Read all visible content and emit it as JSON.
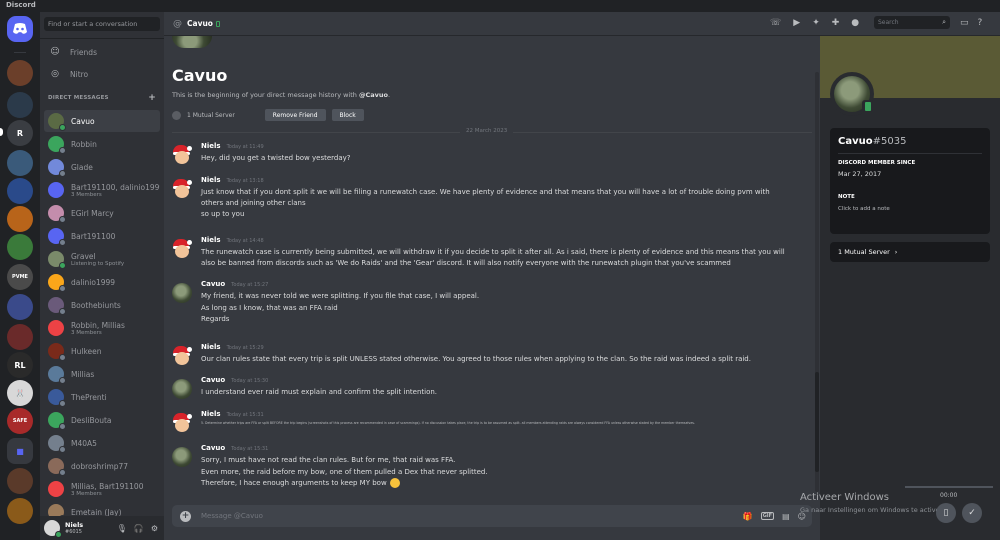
{
  "window": {
    "title": "Discord"
  },
  "sidebar": {
    "search_placeholder": "Find or start a conversation",
    "friends": "Friends",
    "nitro": "Nitro",
    "dm_header": "DIRECT MESSAGES",
    "dms": [
      {
        "name": "Cavuo",
        "sub": "",
        "color": "#5a6a44",
        "status": "#3ba55d",
        "active": true
      },
      {
        "name": "Robbin",
        "sub": "",
        "color": "#3ba55d",
        "status": "#747f8d"
      },
      {
        "name": "Glade",
        "sub": "",
        "color": "#7289da",
        "status": "#747f8d"
      },
      {
        "name": "Bart191100, dalinio1999",
        "sub": "3 Members",
        "color": "#5865f2",
        "status": ""
      },
      {
        "name": "EGirl Marcy",
        "sub": "",
        "color": "#c48dac",
        "status": "#747f8d"
      },
      {
        "name": "Bart191100",
        "sub": "",
        "color": "#5865f2",
        "status": "#747f8d"
      },
      {
        "name": "Gravel",
        "sub": "Listening to Spotify",
        "color": "#7a8a6a",
        "status": "#3ba55d"
      },
      {
        "name": "dalinio1999",
        "sub": "",
        "color": "#faa61a",
        "status": "#747f8d"
      },
      {
        "name": "Boothebiunts",
        "sub": "",
        "color": "#6a5a7a",
        "status": "#747f8d"
      },
      {
        "name": "Robbin, Millias",
        "sub": "3 Members",
        "color": "#ed4245",
        "status": ""
      },
      {
        "name": "Hulkeen",
        "sub": "",
        "color": "#7a2a1a",
        "status": "#747f8d"
      },
      {
        "name": "Millias",
        "sub": "",
        "color": "#5a7a9a",
        "status": "#747f8d"
      },
      {
        "name": "ThePrenti",
        "sub": "",
        "color": "#3a5a9a",
        "status": "#747f8d"
      },
      {
        "name": "DesliBouta",
        "sub": "",
        "color": "#3ba55d",
        "status": "#747f8d"
      },
      {
        "name": "M40A5",
        "sub": "",
        "color": "#747f8d",
        "status": "#747f8d"
      },
      {
        "name": "dobroshrimp77",
        "sub": "",
        "color": "#8a6a5a",
        "status": "#747f8d"
      },
      {
        "name": "Millias, Bart191100",
        "sub": "3 Members",
        "color": "#ed4245",
        "status": ""
      },
      {
        "name": "Emetain (Jay)",
        "sub": "",
        "color": "#9a7a5a",
        "status": "#747f8d"
      }
    ],
    "user": {
      "name": "Niels",
      "tag": "#6015"
    }
  },
  "topbar": {
    "name": "Cavuo",
    "search_placeholder": "Search"
  },
  "chat": {
    "intro_name": "Cavuo",
    "intro_prefix": "This is the beginning of your direct message history with ",
    "intro_handle": "@Cavuo",
    "intro_suffix": ".",
    "mutual": "1 Mutual Server",
    "remove_friend": "Remove Friend",
    "block": "Block",
    "date": "22 March 2023",
    "messages": [
      {
        "author": "Niels",
        "time": "Today at 11:49",
        "lines": [
          "Hey, did you get a twisted bow yesterday?"
        ]
      },
      {
        "author": "Niels",
        "time": "Today at 13:18",
        "lines": [
          "Just know that if you dont split it we will be filing a runewatch case. We have plenty of evidence and that means that you will have a lot of trouble doing pvm with others and joining other clans",
          "so up to you"
        ]
      },
      {
        "author": "Niels",
        "time": "Today at 14:48",
        "lines": [
          "The runewatch case is currently being submitted, we will withdraw it if you decide to split it after all. As i said, there is plenty of evidence and this means that you will also be banned from discords such as 'We do Raids' and the 'Gear' discord. It will also notify everyone with the runewatch plugin that you've scammed"
        ]
      },
      {
        "author": "Cavuo",
        "time": "Today at 15:27",
        "lines": [
          "My friend, it was never told we were splitting. If you file that case, I will appeal.",
          "As long as I know, that was an FFA raid",
          "Regards"
        ]
      },
      {
        "author": "Niels",
        "time": "Today at 15:29",
        "lines": [
          "Our clan rules state that every trip is split UNLESS stated otherwise. You agreed to those rules when applying to the clan. So the raid was indeed a split raid."
        ]
      },
      {
        "author": "Cavuo",
        "time": "Today at 15:30",
        "lines": [
          "I understand ever raid must explain and confirm the split intention."
        ]
      },
      {
        "author": "Niels",
        "time": "Today at 15:31",
        "lines": [
          "5. Determine whether trips are FFA or split BEFORE the trip begins (screenshots of this process are recommended in case of scammings). If no discussion takes place, the trip is to be assumed as split. all members attending raids are always considered FFA unless otherwise stated by the member themselves."
        ]
      },
      {
        "author": "Cavuo",
        "time": "Today at 15:31",
        "lines": [
          "Sorry, I must have not read the clan rules. But for me, that raid was FFA.",
          "Even more, the raid before my bow, one of them pulled a Dex that never splitted.",
          "Therefore, I hace enough arguments to keep MY bow"
        ]
      }
    ],
    "composer_placeholder": "Message @Cavuo"
  },
  "profile": {
    "name": "Cavuo",
    "tag": "#5035",
    "member_since_label": "DISCORD MEMBER SINCE",
    "member_since": "Mar 27, 2017",
    "note_label": "NOTE",
    "note_placeholder": "Click to add a note",
    "mutual": "1 Mutual Server"
  },
  "overlay": {
    "watermark": "Activeer Windows",
    "watermark_sub": "Ga naar Instellingen om Windows te activeren.",
    "time": "00:00"
  },
  "colors": {
    "accent": "#5865f2",
    "online": "#3ba55d"
  }
}
